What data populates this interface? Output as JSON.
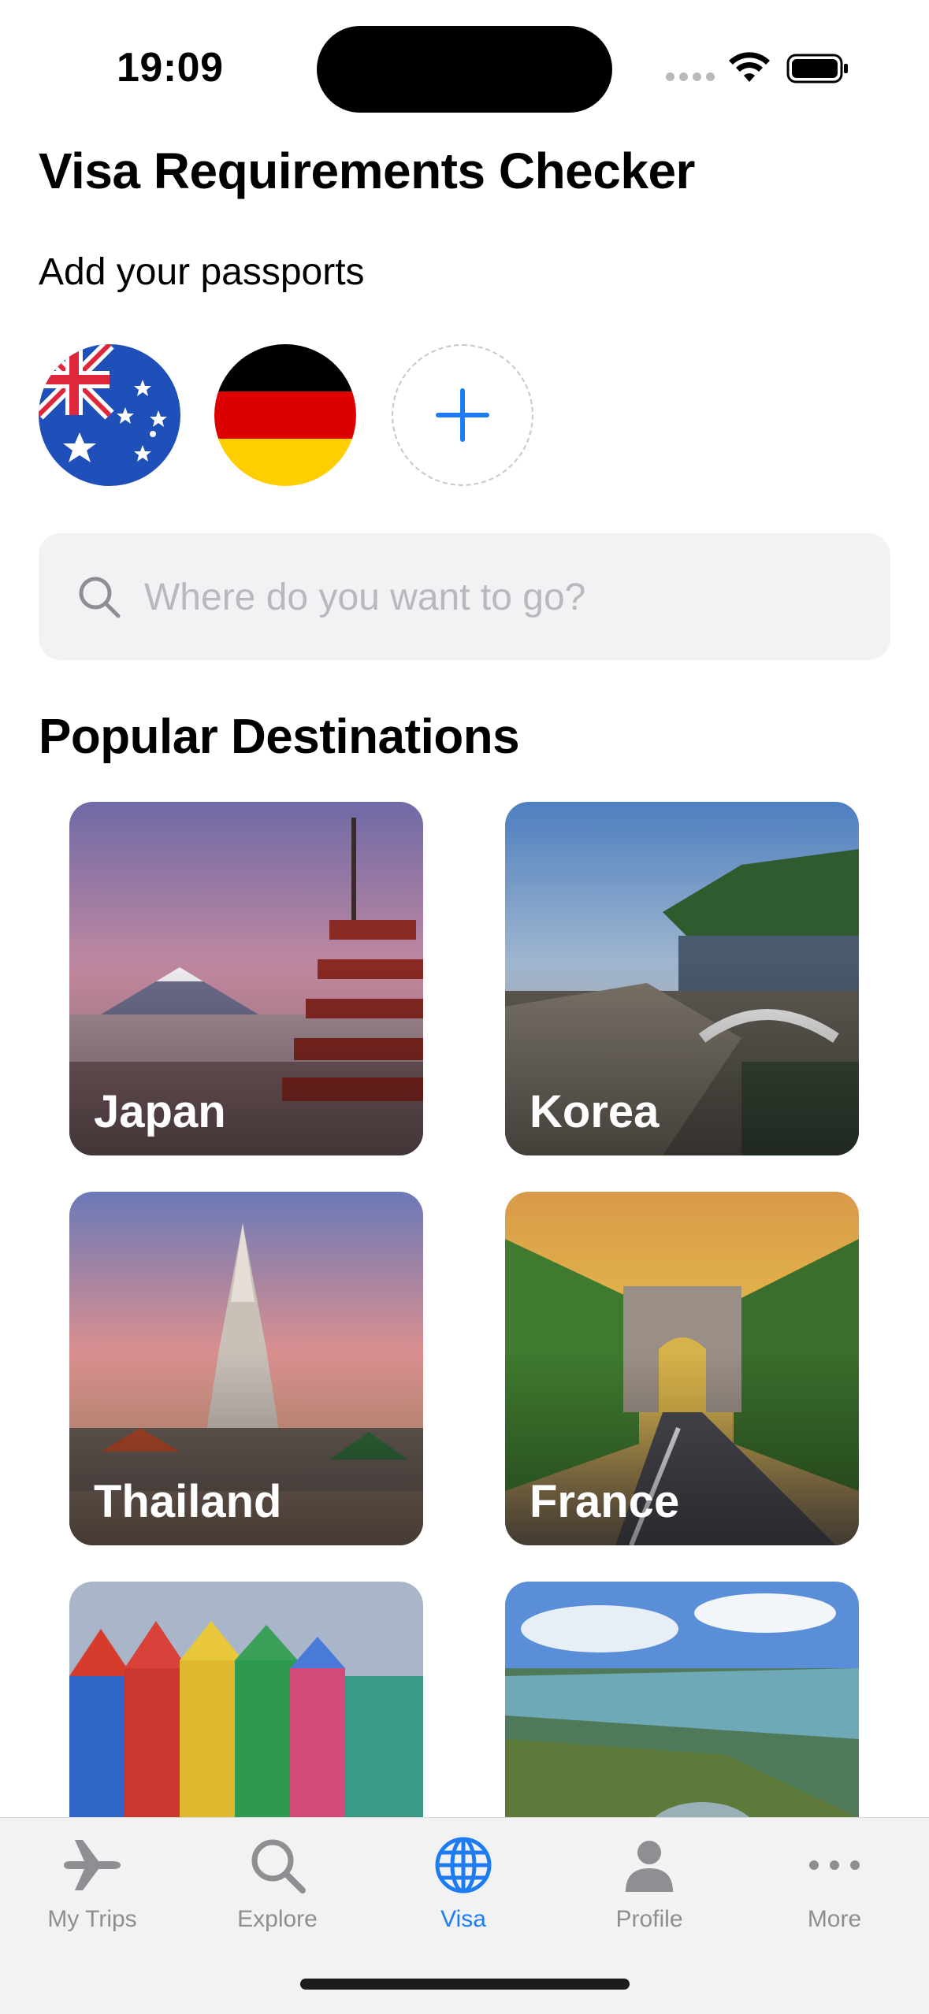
{
  "status_bar": {
    "time": "19:09"
  },
  "header": {
    "title": "Visa Requirements Checker"
  },
  "passports": {
    "label": "Add your passports",
    "flags": [
      "Australia flag",
      "Germany flag"
    ],
    "add_icon": "plus-icon"
  },
  "search": {
    "placeholder": "Where do you want to go?",
    "value": ""
  },
  "popular": {
    "title": "Popular Destinations",
    "destinations": [
      {
        "name": "Japan"
      },
      {
        "name": "Korea"
      },
      {
        "name": "Thailand"
      },
      {
        "name": "France"
      },
      {
        "name": ""
      },
      {
        "name": ""
      }
    ]
  },
  "tab_bar": {
    "active": "Visa",
    "accent_color": "#1e7cf2",
    "tabs": [
      {
        "label": "My Trips",
        "icon": "airplane-icon"
      },
      {
        "label": "Explore",
        "icon": "search-icon"
      },
      {
        "label": "Visa",
        "icon": "globe-icon"
      },
      {
        "label": "Profile",
        "icon": "person-icon"
      },
      {
        "label": "More",
        "icon": "ellipsis-icon"
      }
    ]
  }
}
